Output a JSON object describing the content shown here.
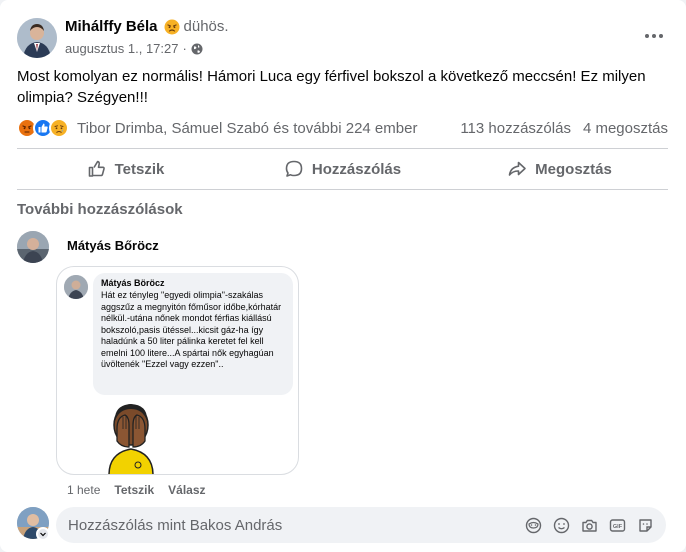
{
  "post": {
    "author": "Mihálffy Béla",
    "mood_icon": "angry-face-icon",
    "mood_text": "dühös.",
    "timestamp": "augusztus 1., 17:27",
    "separator": "·",
    "privacy_icon": "globe-icon",
    "text": "Most komolyan ez normális! Hámori Luca egy férfivel bokszol a következő meccsén! Ez milyen olimpia? Szégyen!!!"
  },
  "reactions": {
    "icons": [
      "angry-reaction-icon",
      "like-reaction-icon",
      "sad-reaction-icon"
    ],
    "names": "Tibor Drimba, Sámuel Szabó és további 224 ember",
    "comments": "113 hozzászólás",
    "shares": "4 megosztás"
  },
  "actions": {
    "like": "Tetszik",
    "comment": "Hozzászólás",
    "share": "Megosztás"
  },
  "more_comments": "További hozzászólások",
  "comment": {
    "author": "Mátyás Bőröcz",
    "image": {
      "inner_author": "Mátyás Böröcz",
      "inner_text": "Hát ez tényleg \"egyedi olimpia\"-szakálas aggszűz a megnyitón főműsor időbe,kórhatár nélkül.-utána nőnek mondot férfias kiállású bokszoló,pasis ütéssel...kicsit gáz-ha így haladúnk a 50 liter pálinka keretet fel kell emelni 100 litere...A spártai nők egyhagúan üvöltenék \"Ezzel vagy ezzen\"..",
      "sticker_icon": "facepalm-sticker-icon"
    },
    "time": "1 hete",
    "like": "Tetszik",
    "reply": "Válasz"
  },
  "composer": {
    "placeholder": "Hozzászólás mint Bakos András",
    "icons": [
      "avatar-sticker-icon",
      "emoji-icon",
      "camera-icon",
      "gif-icon",
      "sticker-icon"
    ]
  },
  "colors": {
    "secondary_text": "#65676b",
    "angry": "#e9710f",
    "like": "#1877f2",
    "sad": "#f7b125"
  }
}
